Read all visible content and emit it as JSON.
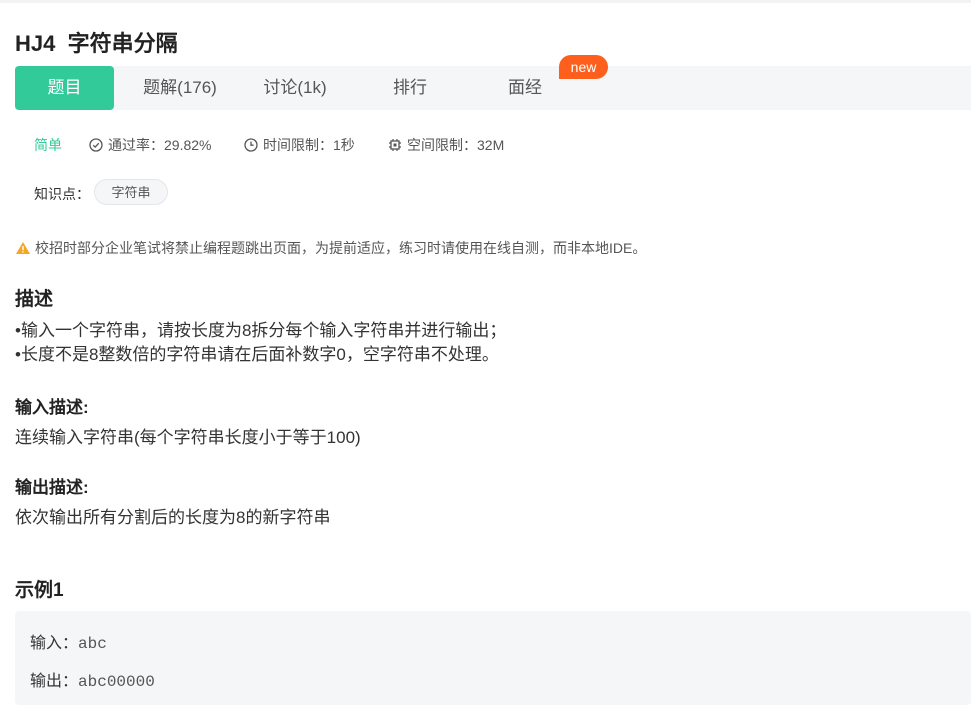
{
  "problem": {
    "title": "HJ4  字符串分隔",
    "difficulty": "简单",
    "pass_rate": "通过率：29.82%",
    "time_limit": "时间限制：1秒",
    "space_limit": "空间限制：32M",
    "knowledge_label": "知识点：",
    "tags": [
      "字符串"
    ],
    "warning": "校招时部分企业笔试将禁止编程题跳出页面，为提前适应，练习时请使用在线自测，而非本地IDE。"
  },
  "tabs": [
    {
      "label": "题目",
      "active": true
    },
    {
      "label": "题解(176)",
      "active": false
    },
    {
      "label": "讨论(1k)",
      "active": false
    },
    {
      "label": "排行",
      "active": false
    },
    {
      "label": "面经",
      "active": false
    }
  ],
  "new_badge": "new",
  "description": {
    "heading": "描述",
    "lines": [
      "•输入一个字符串，请按长度为8拆分每个输入字符串并进行输出；",
      "•长度不是8整数倍的字符串请在后面补数字0，空字符串不处理。"
    ]
  },
  "input_desc": {
    "heading": "输入描述:",
    "text": "连续输入字符串(每个字符串长度小于等于100)"
  },
  "output_desc": {
    "heading": "输出描述:",
    "text": "依次输出所有分割后的长度为8的新字符串"
  },
  "example": {
    "heading": "示例1",
    "input_label": "输入：",
    "input_value": "abc",
    "output_label": "输出：",
    "output_value": "abc00000"
  },
  "colors": {
    "accent": "#32ca99",
    "badge": "#fe5f1c",
    "warning": "#f5a623"
  }
}
